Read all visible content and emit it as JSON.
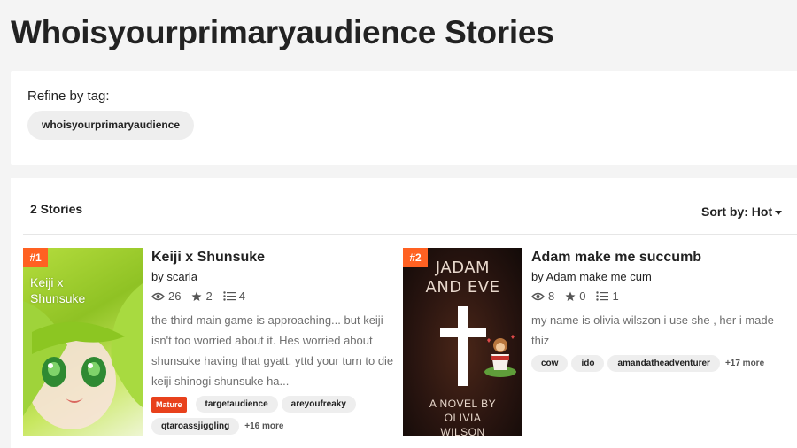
{
  "page": {
    "title": "Whoisyourprimaryaudience Stories"
  },
  "refine": {
    "label": "Refine by tag:",
    "tag": "whoisyourprimaryaudience"
  },
  "results": {
    "count_label": "2 Stories",
    "sort_label": "Sort by: Hot"
  },
  "stories": [
    {
      "rank": "#1",
      "title": "Keiji x Shunsuke",
      "author": "by scarla",
      "views": "26",
      "votes": "2",
      "parts": "4",
      "description": "the third main game is approaching... but keiji isn't too worried about it. Hes worried about shunsuke having that gyatt. yttd your turn to die keiji shinogi shunsuke ha...",
      "mature_label": "Mature",
      "tags": [
        "targetaudience",
        "areyoufreaky",
        "qtaroassjiggling"
      ],
      "more_tags": "+16 more",
      "cover_text": "Keiji x Shunsuke"
    },
    {
      "rank": "#2",
      "title": "Adam make me succumb",
      "author": "by Adam make me cum",
      "views": "8",
      "votes": "0",
      "parts": "1",
      "description": "my name is olivia wilszon i use she , her i made thiz",
      "tags": [
        "cow",
        "ido",
        "amandatheadventurer"
      ],
      "more_tags": "+17 more",
      "cover_title": "JADAM AND EVE",
      "cover_subtitle": "A NOVEL BY OLIVIA WILSON"
    }
  ],
  "colors": {
    "accent": "#ff6122",
    "mature": "#e8411c",
    "tag_bg": "#eeeeee"
  },
  "icons": {
    "views": "eye-icon",
    "votes": "star-icon",
    "parts": "list-icon",
    "sort": "caret-down-icon"
  }
}
